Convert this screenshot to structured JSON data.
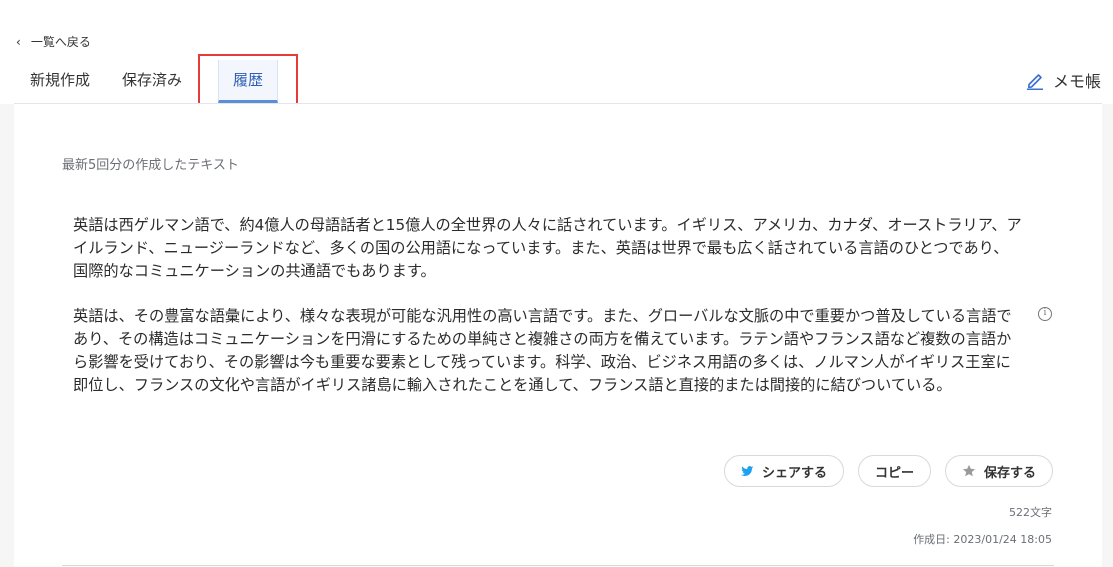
{
  "nav": {
    "back_label": "一覧へ戻る",
    "back_icon": "chevron-left-icon"
  },
  "tabs": [
    {
      "label": "新規作成",
      "active": false
    },
    {
      "label": "保存済み",
      "active": false
    },
    {
      "label": "履歴",
      "active": true
    }
  ],
  "memo": {
    "label": "メモ帳",
    "icon": "pencil-icon",
    "icon_color": "#3a6fd0"
  },
  "history": {
    "subtitle": "最新5回分の作成したテキスト",
    "paragraphs": [
      "英語は西ゲルマン語で、約4億人の母語話者と15億人の全世界の人々に話されています。イギリス、アメリカ、カナダ、オーストラリア、アイルランド、ニュージーランドなど、多くの国の公用語になっています。また、英語は世界で最も広く話されている言語のひとつであり、国際的なコミュニケーションの共通語でもあります。",
      "英語は、その豊富な語彙により、様々な表現が可能な汎用性の高い言語です。また、グローバルな文脈の中で重要かつ普及している言語であり、その構造はコミュニケーションを円滑にするための単純さと複雑さの両方を備えています。ラテン語やフランス語など複数の言語から影響を受けており、その影響は今も重要な要素として残っています。科学、政治、ビジネス用語の多くは、ノルマン人がイギリス王室に即位し、フランスの文化や言語がイギリス諸島に輸入されたことを通して、フランス語と直接的または間接的に結びついている。"
    ],
    "info_icon": "info-icon",
    "actions": {
      "share_label": "シェアする",
      "share_icon": "twitter-icon",
      "share_icon_color": "#1da1f2",
      "copy_label": "コピー",
      "save_label": "保存する",
      "save_icon": "star-icon"
    },
    "char_count": "522文字",
    "created_at": "作成日: 2023/01/24 18:05"
  },
  "colors": {
    "active_tab_text": "#2f5fb3",
    "active_tab_underline": "#5a8fd8",
    "highlight_border": "#e43b3b"
  }
}
